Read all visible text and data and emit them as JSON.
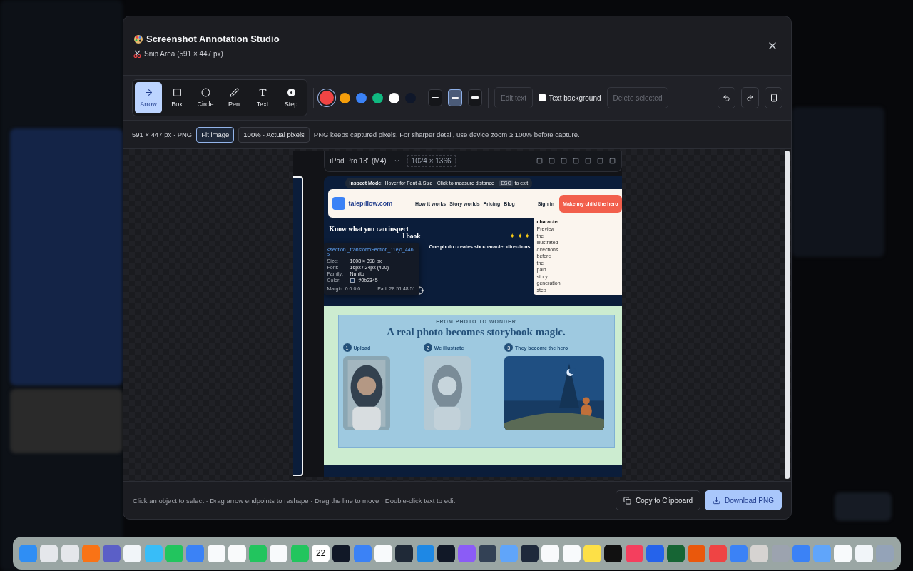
{
  "modal": {
    "title": "Screenshot Annotation Studio",
    "subtitle": "Snip Area (591 × 447 px)"
  },
  "tools": [
    {
      "kind": "arrow",
      "label": "Arrow",
      "selected": true
    },
    {
      "kind": "box",
      "label": "Box",
      "selected": false
    },
    {
      "kind": "circle",
      "label": "Circle",
      "selected": false
    },
    {
      "kind": "pen",
      "label": "Pen",
      "selected": false
    },
    {
      "kind": "text",
      "label": "Text",
      "selected": false
    },
    {
      "kind": "step",
      "label": "Step",
      "selected": false
    }
  ],
  "colors": [
    {
      "color": "#ef4444",
      "selected": true
    },
    {
      "color": "#f59e0b",
      "selected": false
    },
    {
      "color": "#3b82f6",
      "selected": false
    },
    {
      "color": "#10b981",
      "selected": false
    },
    {
      "color": "#ffffff",
      "selected": false
    },
    {
      "color": "#0f172a",
      "selected": false
    }
  ],
  "widths": [
    {
      "kind": "thin",
      "selected": false
    },
    {
      "kind": "medium",
      "selected": true
    },
    {
      "kind": "thick",
      "selected": false
    }
  ],
  "edit_text": {
    "label": "Edit text",
    "disabled": true
  },
  "text_background": {
    "label": "Text background",
    "checked": false
  },
  "delete_selected": {
    "label": "Delete selected",
    "disabled": true
  },
  "info": {
    "size": "591 × 447 px · PNG",
    "modes": [
      {
        "label": "Fit image",
        "selected": true
      },
      {
        "label": "100% · Actual pixels",
        "selected": false
      }
    ],
    "note": "PNG keeps captured pixels. For sharper detail, use device zoom ≥ 100% before capture."
  },
  "capture": {
    "device": "iPad Pro 13\" (M4)",
    "resolution": "1024 × 1366",
    "logo": "talepillow.com",
    "nav": [
      "How it works",
      "Story worlds",
      "Pricing",
      "Blog"
    ],
    "sign_in": "Sign in",
    "cta": "Make my child the hero",
    "inspect_banner": {
      "label": "Inspect Mode:",
      "text": "Hover for Font & Size · Click to measure distance ·",
      "key": "ESC",
      "end": "to exit"
    },
    "hero_heading": [
      "Know what you can inspect",
      "l book"
    ],
    "stars": "✦ ✦ ✦",
    "hero_caption": "One photo creates six character directions",
    "card": {
      "title": "character",
      "lines": [
        "Preview",
        "the",
        "illustrated",
        "directions",
        "before",
        "the",
        "paid",
        "story",
        "generation",
        "step"
      ]
    },
    "tooltip": {
      "selector": "<section._transformSection_11ejd_446>",
      "rows": [
        {
          "key": "Size:",
          "value": "1008 × 398 px"
        },
        {
          "key": "Font:",
          "value": "16px / 24px (400)"
        },
        {
          "key": "Family:",
          "value": "Nunito"
        },
        {
          "key": "Color:",
          "value": "#0b2345",
          "color": "#0b2345"
        }
      ],
      "margin": "Margin: 0 0 0 0",
      "pad": "Pad: 28 51 48 51"
    },
    "eyebrow": "FROM PHOTO TO WONDER",
    "headline": "A real photo becomes storybook magic.",
    "steps": [
      {
        "number": "1",
        "title": "Upload"
      },
      {
        "number": "2",
        "title": "We illustrate"
      },
      {
        "number": "3",
        "title": "They become the hero"
      }
    ],
    "pictures": [
      {
        "kind": "picture"
      },
      {
        "kind": "picture"
      },
      {
        "kind": "picture"
      }
    ]
  },
  "footer": {
    "hint": "Click an object to select · Drag arrow endpoints to reshape · Drag the line to move · Double-click text to edit",
    "buttons": [
      {
        "kind": "copy",
        "label": "Copy to Clipboard"
      },
      {
        "kind": "download",
        "label": "Download PNG"
      }
    ]
  },
  "dock": [
    {
      "color": "#2f8ef4"
    },
    {
      "color": "#e5e7eb"
    },
    {
      "color": "#e5e7eb"
    },
    {
      "color": "#f97316"
    },
    {
      "color": "#5b5fc7"
    },
    {
      "color": "#f1f5f9"
    },
    {
      "color": "#38bdf8"
    },
    {
      "color": "#22c55e"
    },
    {
      "color": "#3b82f6"
    },
    {
      "color": "#f8fafc"
    },
    {
      "color": "#f9fafb"
    },
    {
      "color": "#22c55e"
    },
    {
      "color": "#f8fafc"
    },
    {
      "color": "#22c55e"
    },
    {
      "color": "#ffffff",
      "label": "22"
    },
    {
      "color": "#111827"
    },
    {
      "color": "#3b82f6"
    },
    {
      "color": "#f8fafc"
    },
    {
      "color": "#1f2937"
    },
    {
      "color": "#1e88e5"
    },
    {
      "color": "#111827"
    },
    {
      "color": "#8b5cf6"
    },
    {
      "color": "#334155"
    },
    {
      "color": "#60a5fa"
    },
    {
      "color": "#1e293b"
    },
    {
      "color": "#f8fafc"
    },
    {
      "color": "#f8fafc"
    },
    {
      "color": "#fde047"
    },
    {
      "color": "#111111"
    },
    {
      "color": "#f43f5e"
    },
    {
      "color": "#2563eb"
    },
    {
      "color": "#166534"
    },
    {
      "color": "#ea580c"
    },
    {
      "color": "#ef4444"
    },
    {
      "color": "#3b82f6"
    },
    {
      "color": "#d6d3d1"
    },
    {
      "color": "#9ca3af"
    },
    {
      "color": "#3b82f6"
    },
    {
      "color": "#60a5fa"
    },
    {
      "color": "#f8fafc"
    },
    {
      "color": "#f1f5f9"
    },
    {
      "color": "#94a3b8"
    }
  ]
}
